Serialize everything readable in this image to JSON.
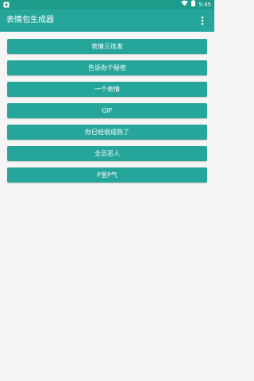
{
  "status_bar": {
    "time": "5:45",
    "icons": [
      "notification-icon",
      "wifi-icon",
      "battery-icon"
    ]
  },
  "app_bar": {
    "title": "表情包生成器",
    "menu_icon": "more-vert-icon"
  },
  "buttons": [
    {
      "label": "表情三连发"
    },
    {
      "label": "告诉你个秘密"
    },
    {
      "label": "一个表情"
    },
    {
      "label": "GIF"
    },
    {
      "label": "你已经很成熟了"
    },
    {
      "label": "全员恶人"
    },
    {
      "label": "P里P气"
    }
  ],
  "colors": {
    "status_bar": "#1f9b8b",
    "primary": "#26a69a",
    "background": "#f5f5f5",
    "text_on_primary": "#ffffff"
  }
}
